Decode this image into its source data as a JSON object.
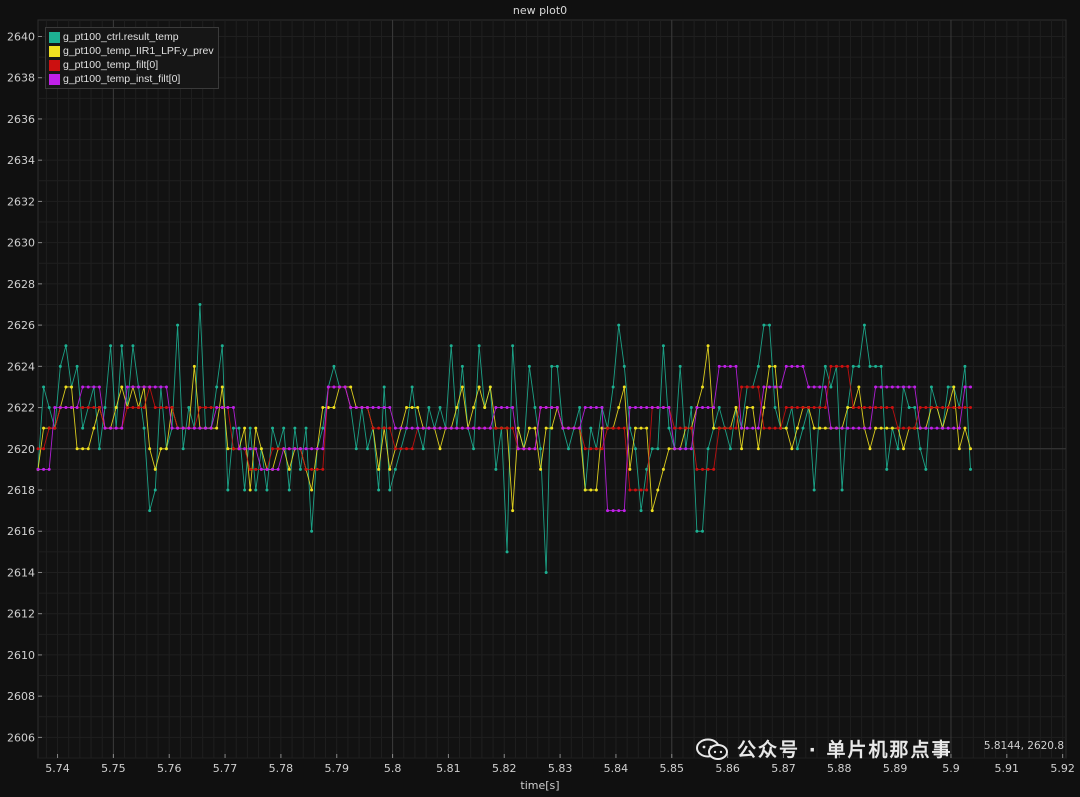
{
  "chart_data": {
    "type": "line",
    "title": "new plot0",
    "xlabel": "time[s]",
    "ylabel": "",
    "xlim": [
      5.7365,
      5.9206
    ],
    "ylim": [
      2605,
      2640.8
    ],
    "x_ticks": [
      "5.74",
      "5.75",
      "5.76",
      "5.77",
      "5.78",
      "5.79",
      "5.8",
      "5.81",
      "5.82",
      "5.83",
      "5.84",
      "5.85",
      "5.86",
      "5.87",
      "5.88",
      "5.89",
      "5.9",
      "5.91",
      "5.92"
    ],
    "y_ticks": [
      "2606",
      "2608",
      "2610",
      "2612",
      "2614",
      "2616",
      "2618",
      "2620",
      "2622",
      "2624",
      "2626",
      "2628",
      "2630",
      "2632",
      "2634",
      "2636",
      "2638",
      "2640"
    ],
    "grid": true,
    "legend_position": "top-left",
    "x_start": 5.7365,
    "x_step": 0.001,
    "series": [
      {
        "name": "g_pt100_ctrl.result_temp",
        "color": "#1db092",
        "values": [
          2619,
          2623,
          2622,
          2621,
          2624,
          2625,
          2623,
          2624,
          2621,
          2622,
          2623,
          2620,
          2622,
          2625,
          2621,
          2625,
          2622,
          2625,
          2623,
          2621,
          2617,
          2618,
          2623,
          2620,
          2621,
          2626,
          2620,
          2622,
          2621,
          2627,
          2621,
          2621,
          2623,
          2625,
          2618,
          2621,
          2621,
          2618,
          2621,
          2618,
          2620,
          2618,
          2621,
          2620,
          2621,
          2618,
          2621,
          2619,
          2621,
          2616,
          2620,
          2621,
          2623,
          2624,
          2623,
          2623,
          2622,
          2620,
          2622,
          2620,
          2621,
          2618,
          2623,
          2618,
          2619,
          2620,
          2621,
          2623,
          2621,
          2620,
          2622,
          2621,
          2622,
          2621,
          2625,
          2621,
          2624,
          2621,
          2620,
          2625,
          2622,
          2623,
          2619,
          2621,
          2615,
          2625,
          2621,
          2620,
          2624,
          2622,
          2620,
          2614,
          2624,
          2624,
          2621,
          2620,
          2621,
          2622,
          2618,
          2621,
          2620,
          2622,
          2621,
          2623,
          2626,
          2624,
          2621,
          2620,
          2617,
          2619,
          2620,
          2620,
          2625,
          2621,
          2620,
          2624,
          2620,
          2622,
          2616,
          2616,
          2620,
          2621,
          2622,
          2621,
          2620,
          2622,
          2621,
          2623,
          2623,
          2624,
          2626,
          2626,
          2622,
          2621,
          2621,
          2622,
          2620,
          2621,
          2622,
          2618,
          2622,
          2624,
          2623,
          2624,
          2618,
          2622,
          2624,
          2624,
          2626,
          2624,
          2624,
          2624,
          2619,
          2621,
          2620,
          2623,
          2622,
          2622,
          2620,
          2619,
          2623,
          2622,
          2621,
          2623,
          2623,
          2622,
          2624,
          2619
        ]
      },
      {
        "name": "g_pt100_temp_IIR1_LPF.y_prev",
        "color": "#f0e020",
        "values": [
          2619,
          2621,
          2621,
          2621,
          2622,
          2623,
          2623,
          2620,
          2620,
          2620,
          2621,
          2622,
          2621,
          2621,
          2622,
          2623,
          2622,
          2623,
          2622,
          2623,
          2620,
          2619,
          2620,
          2620,
          2622,
          2621,
          2621,
          2621,
          2624,
          2621,
          2621,
          2621,
          2621,
          2623,
          2620,
          2620,
          2620,
          2621,
          2618,
          2621,
          2620,
          2619,
          2619,
          2620,
          2620,
          2619,
          2620,
          2620,
          2619,
          2618,
          2620,
          2622,
          2622,
          2622,
          2623,
          2623,
          2623,
          2622,
          2622,
          2622,
          2621,
          2619,
          2621,
          2619,
          2620,
          2621,
          2622,
          2622,
          2622,
          2621,
          2621,
          2621,
          2620,
          2621,
          2621,
          2622,
          2623,
          2621,
          2622,
          2623,
          2622,
          2623,
          2621,
          2621,
          2621,
          2617,
          2621,
          2620,
          2621,
          2621,
          2619,
          2621,
          2621,
          2622,
          2621,
          2621,
          2621,
          2621,
          2618,
          2618,
          2618,
          2621,
          2621,
          2621,
          2622,
          2623,
          2619,
          2621,
          2621,
          2621,
          2617,
          2618,
          2619,
          2620,
          2620,
          2620,
          2621,
          2621,
          2622,
          2623,
          2625,
          2621,
          2621,
          2621,
          2621,
          2622,
          2620,
          2622,
          2622,
          2620,
          2622,
          2624,
          2624,
          2621,
          2621,
          2620,
          2621,
          2622,
          2622,
          2621,
          2621,
          2621,
          2621,
          2621,
          2621,
          2622,
          2622,
          2623,
          2621,
          2620,
          2621,
          2621,
          2621,
          2621,
          2621,
          2620,
          2621,
          2621,
          2621,
          2621,
          2622,
          2622,
          2621,
          2622,
          2623,
          2620,
          2621,
          2620
        ]
      },
      {
        "name": "g_pt100_temp_filt[0]",
        "color": "#cc1010",
        "values": [
          2620,
          2620,
          2621,
          2621,
          2622,
          2622,
          2622,
          2622,
          2622,
          2622,
          2622,
          2622,
          2621,
          2621,
          2621,
          2621,
          2622,
          2622,
          2622,
          2622,
          2623,
          2622,
          2622,
          2622,
          2622,
          2621,
          2621,
          2621,
          2621,
          2622,
          2622,
          2622,
          2622,
          2622,
          2622,
          2620,
          2620,
          2620,
          2619,
          2619,
          2619,
          2619,
          2620,
          2620,
          2620,
          2620,
          2620,
          2620,
          2619,
          2619,
          2619,
          2619,
          2623,
          2623,
          2623,
          2623,
          2622,
          2622,
          2622,
          2622,
          2621,
          2621,
          2621,
          2621,
          2620,
          2620,
          2620,
          2620,
          2621,
          2621,
          2621,
          2621,
          2621,
          2621,
          2621,
          2621,
          2621,
          2621,
          2621,
          2621,
          2621,
          2621,
          2621,
          2621,
          2621,
          2621,
          2620,
          2620,
          2620,
          2620,
          2622,
          2622,
          2622,
          2622,
          2621,
          2621,
          2621,
          2621,
          2620,
          2620,
          2620,
          2620,
          2621,
          2621,
          2621,
          2621,
          2618,
          2618,
          2618,
          2618,
          2622,
          2622,
          2622,
          2622,
          2621,
          2621,
          2621,
          2621,
          2619,
          2619,
          2619,
          2619,
          2621,
          2621,
          2621,
          2621,
          2623,
          2623,
          2623,
          2623,
          2621,
          2621,
          2621,
          2621,
          2622,
          2622,
          2622,
          2622,
          2622,
          2622,
          2622,
          2622,
          2624,
          2624,
          2624,
          2624,
          2622,
          2622,
          2622,
          2622,
          2622,
          2622,
          2622,
          2622,
          2621,
          2621,
          2621,
          2621,
          2622,
          2622,
          2622,
          2622,
          2622,
          2622,
          2622,
          2622,
          2622,
          2622
        ]
      },
      {
        "name": "g_pt100_temp_inst_filt[0]",
        "color": "#c020e8",
        "values": [
          2619,
          2619,
          2619,
          2622,
          2622,
          2622,
          2622,
          2622,
          2623,
          2623,
          2623,
          2623,
          2621,
          2621,
          2621,
          2621,
          2623,
          2623,
          2623,
          2623,
          2623,
          2623,
          2623,
          2623,
          2621,
          2621,
          2621,
          2621,
          2621,
          2621,
          2621,
          2621,
          2622,
          2622,
          2622,
          2622,
          2620,
          2620,
          2620,
          2620,
          2619,
          2619,
          2619,
          2619,
          2620,
          2620,
          2620,
          2620,
          2620,
          2620,
          2620,
          2620,
          2623,
          2623,
          2623,
          2623,
          2622,
          2622,
          2622,
          2622,
          2622,
          2622,
          2622,
          2622,
          2621,
          2621,
          2621,
          2621,
          2621,
          2621,
          2621,
          2621,
          2621,
          2621,
          2621,
          2621,
          2621,
          2621,
          2621,
          2621,
          2621,
          2621,
          2622,
          2622,
          2622,
          2622,
          2620,
          2620,
          2620,
          2620,
          2622,
          2622,
          2622,
          2622,
          2621,
          2621,
          2621,
          2621,
          2622,
          2622,
          2622,
          2622,
          2617,
          2617,
          2617,
          2617,
          2622,
          2622,
          2622,
          2622,
          2622,
          2622,
          2622,
          2622,
          2620,
          2620,
          2620,
          2620,
          2622,
          2622,
          2622,
          2622,
          2624,
          2624,
          2624,
          2624,
          2621,
          2621,
          2621,
          2621,
          2623,
          2623,
          2623,
          2623,
          2624,
          2624,
          2624,
          2624,
          2623,
          2623,
          2623,
          2623,
          2621,
          2621,
          2621,
          2621,
          2621,
          2621,
          2621,
          2621,
          2623,
          2623,
          2623,
          2623,
          2623,
          2623,
          2623,
          2623,
          2621,
          2621,
          2621,
          2621,
          2621,
          2621,
          2621,
          2621,
          2623,
          2623
        ]
      }
    ]
  },
  "watermark": {
    "text": "公众号 · 单片机那点事"
  },
  "cursor_readout": "5.8144, 2620.8"
}
